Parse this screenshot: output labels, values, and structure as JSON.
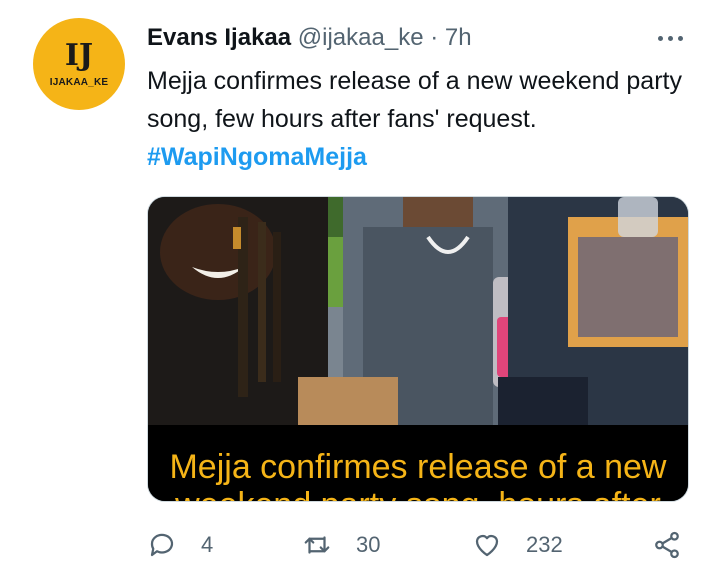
{
  "author": {
    "avatar_text": "IJ",
    "avatar_handle": "IJAKAA_KE",
    "name": "Evans Ijakaa",
    "handle": "@ijakaa_ke",
    "separator": " · ",
    "time": "7h"
  },
  "tweet": {
    "text": "Mejja confirmes release of a new weekend party song, few hours after fans' request.",
    "hashtag": "#WapiNgomaMejja"
  },
  "media": {
    "caption_line1": "Mejja confirmes release of a new",
    "caption_line2": "weekend party song, hours after"
  },
  "actions": {
    "reply_count": "4",
    "retweet_count": "30",
    "like_count": "232"
  },
  "colors": {
    "accent": "#1d9bf0",
    "avatar_bg": "#f5b417",
    "muted": "#536471"
  }
}
